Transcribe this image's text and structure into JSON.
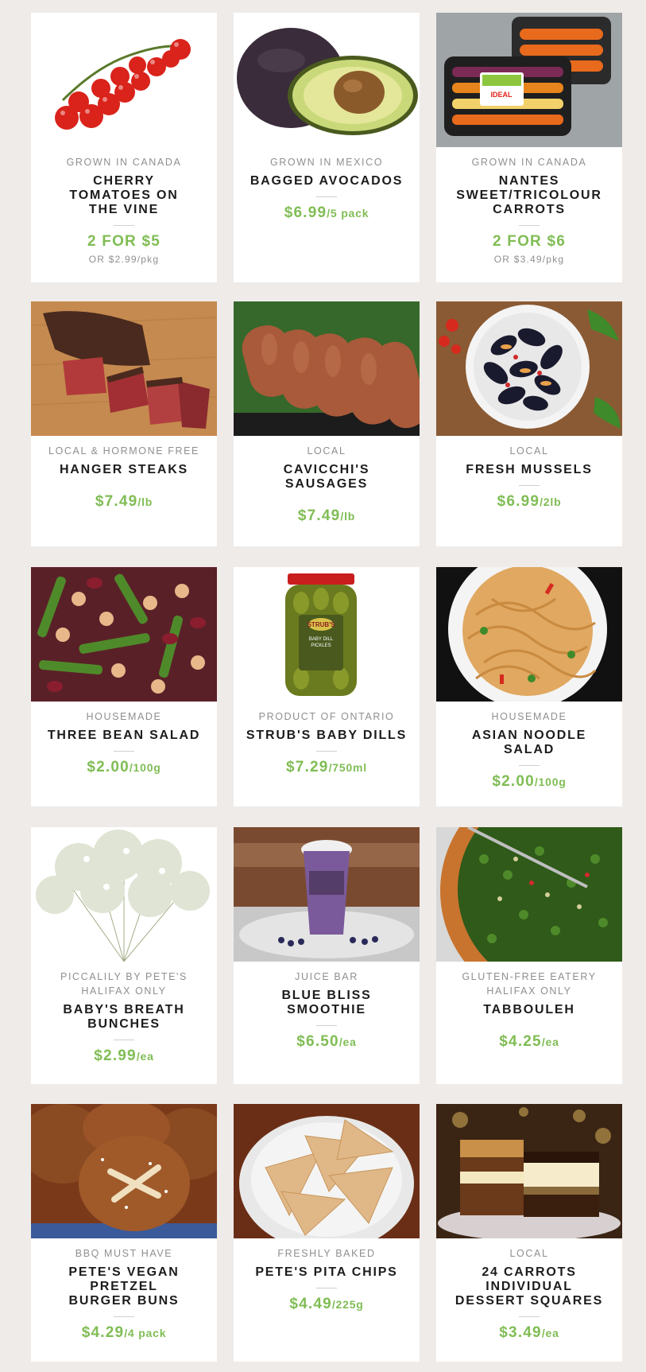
{
  "colors": {
    "background": "#efebe8",
    "card": "#ffffff",
    "price": "#80bd55",
    "origin": "#8f8f8f",
    "name": "#1c1c1c"
  },
  "products": [
    {
      "image": "cherry-tomatoes-image",
      "origin": "GROWN IN CANADA",
      "name": "CHERRY TOMATOES ON THE VINE",
      "price": "2 FOR $5",
      "unit": "",
      "alt_price": "OR $2.99",
      "alt_unit": "/pkg"
    },
    {
      "image": "avocado-image",
      "origin": "GROWN IN MEXICO",
      "name": "BAGGED AVOCADOS",
      "price": "$6.99",
      "unit": "/5 pack"
    },
    {
      "image": "carrots-image",
      "origin": "GROWN IN CANADA",
      "name": "NANTES SWEET/TRICOLOUR CARROTS",
      "price": "2 FOR $6",
      "unit": "",
      "alt_price": "OR $3.49",
      "alt_unit": "/pkg"
    },
    {
      "image": "hanger-steak-image",
      "origin": "LOCAL & HORMONE FREE",
      "name": "HANGER STEAKS",
      "price": "$7.49",
      "unit": "/lb"
    },
    {
      "image": "sausages-image",
      "origin": "LOCAL",
      "name": "CAVICCHI'S SAUSAGES",
      "price": "$7.49",
      "unit": "/lb"
    },
    {
      "image": "mussels-image",
      "origin": "LOCAL",
      "name": "FRESH MUSSELS",
      "price": "$6.99",
      "unit": "/2lb"
    },
    {
      "image": "bean-salad-image",
      "origin": "HOUSEMADE",
      "name": "THREE BEAN SALAD",
      "price": "$2.00",
      "unit": "/100g"
    },
    {
      "image": "pickle-jar-image",
      "origin": "PRODUCT OF ONTARIO",
      "name": "STRUB'S BABY DILLS",
      "price": "$7.29",
      "unit": "/750ml"
    },
    {
      "image": "noodle-salad-image",
      "origin": "HOUSEMADE",
      "name": "ASIAN NOODLE SALAD",
      "price": "$2.00",
      "unit": "/100g"
    },
    {
      "image": "babys-breath-image",
      "origin": "PICCALILY BY PETE'S",
      "origin2": "HALIFAX ONLY",
      "name": "BABY'S BREATH BUNCHES",
      "price": "$2.99",
      "unit": "/ea"
    },
    {
      "image": "smoothie-image",
      "origin": "JUICE BAR",
      "name": "BLUE BLISS SMOOTHIE",
      "price": "$6.50",
      "unit": "/ea"
    },
    {
      "image": "tabbouleh-image",
      "origin": "GLUTEN-FREE EATERY",
      "origin2": "HALIFAX ONLY",
      "name": "TABBOULEH",
      "price": "$4.25",
      "unit": "/ea"
    },
    {
      "image": "pretzel-buns-image",
      "origin": "BBQ MUST HAVE",
      "name": "PETE'S VEGAN PRETZEL BURGER BUNS",
      "price": "$4.29",
      "unit": "/4 pack"
    },
    {
      "image": "pita-chips-image",
      "origin": "FRESHLY BAKED",
      "name": "PETE'S PITA CHIPS",
      "price": "$4.49",
      "unit": "/225g"
    },
    {
      "image": "dessert-squares-image",
      "origin": "LOCAL",
      "name": "24 CARROTS INDIVIDUAL DESSERT SQUARES",
      "price": "$3.49",
      "unit": "/ea"
    }
  ],
  "image_texts": {
    "carrot_label": "IDEAL",
    "pickle_label_brand": "STRUB'S",
    "pickle_label_lines": [
      "BABY DILL",
      "PICKLES"
    ]
  }
}
